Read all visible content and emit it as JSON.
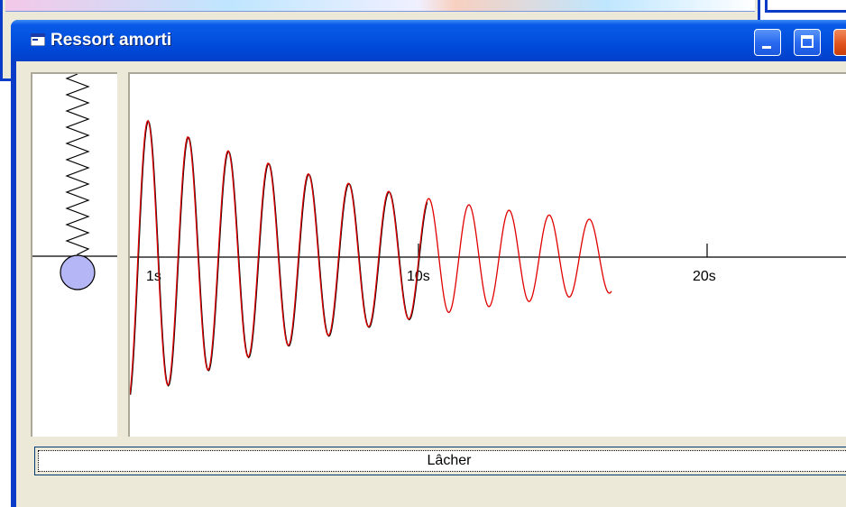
{
  "window": {
    "title": "Ressort amorti",
    "icon": "app-window-icon"
  },
  "titlebar_buttons": [
    "minimize-button",
    "maximize-button",
    "close-button"
  ],
  "graph": {
    "axis_ticks": [
      "1s",
      "10s",
      "20s"
    ],
    "curve_color": "#e00000",
    "axis_color": "#000000"
  },
  "release_button": {
    "label": "Lâcher"
  },
  "colors": {
    "titlebar": "#0453e0",
    "window_border": "#0a3cc8",
    "client_bg": "#ece9d8",
    "mass": "#b4b6f6"
  }
}
